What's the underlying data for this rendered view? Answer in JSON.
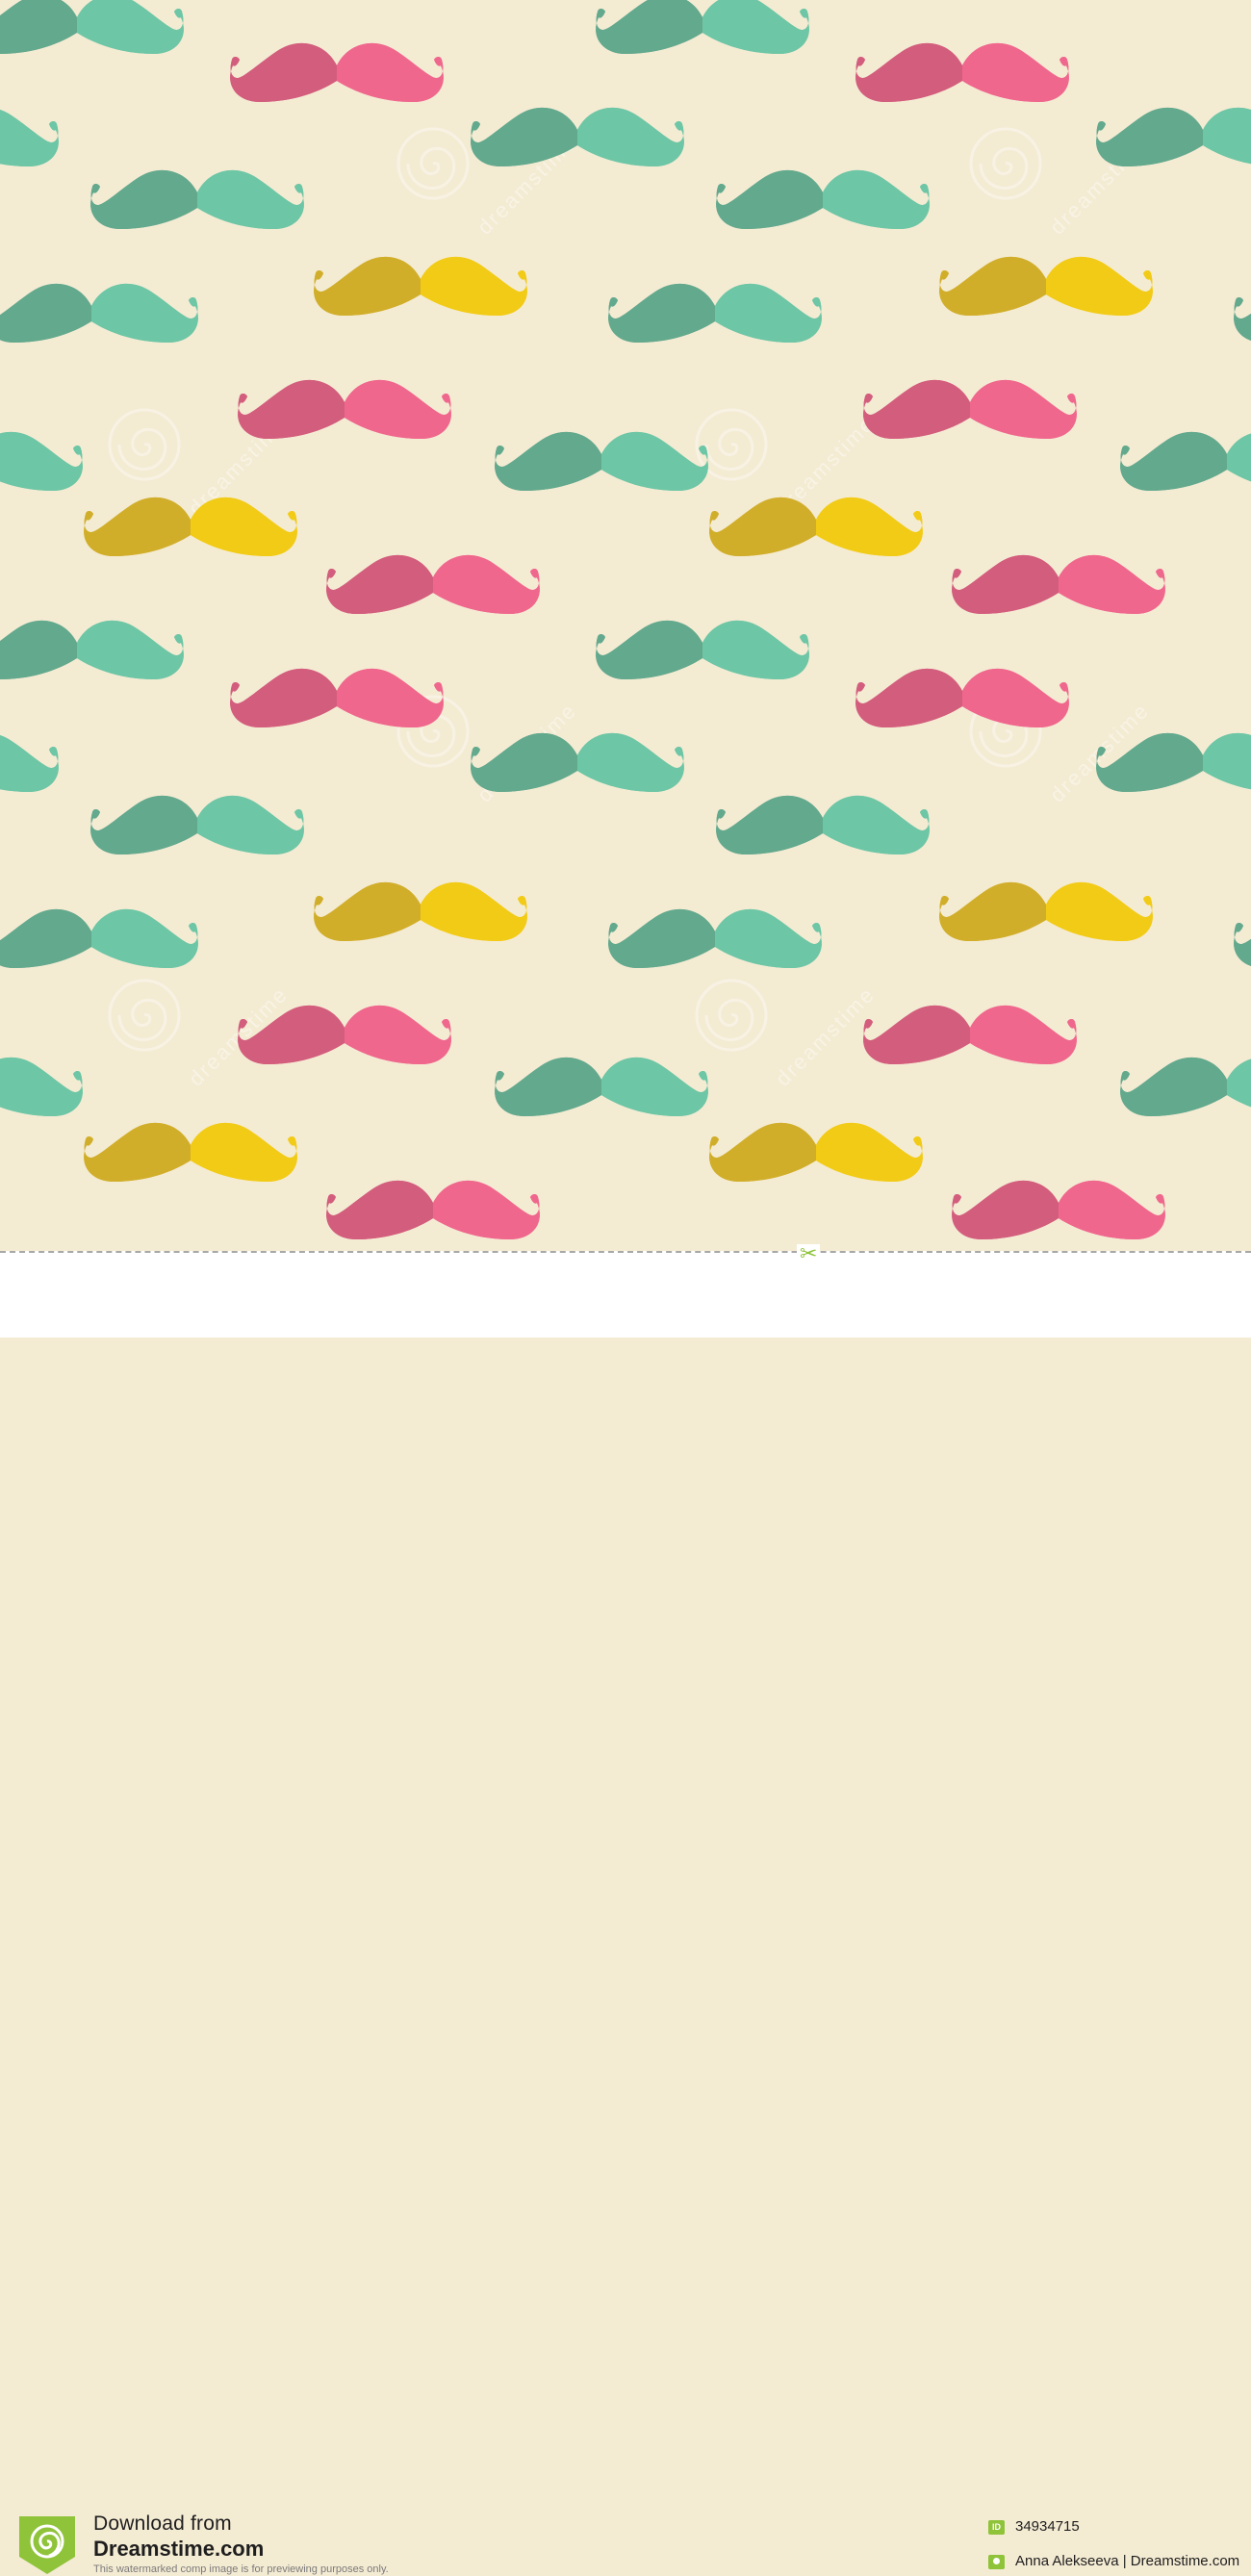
{
  "pattern": {
    "background_color": "#f4ebd3",
    "motif": "mustache-icon",
    "palettes": {
      "green": [
        "#63a98d",
        "#6dc6a5"
      ],
      "pink": [
        "#d35d7d",
        "#f0678d"
      ],
      "yellow": [
        "#d1ae2a",
        "#f2cb16"
      ]
    },
    "watermark": {
      "icon": "spiral-logo-icon",
      "text": "dreamstime"
    }
  },
  "footer": {
    "download_label": "Download from",
    "site_label": "Dreamstime.com",
    "disclaimer": "This watermarked comp image is for previewing purposes only.",
    "id_badge": "ID",
    "image_id": "34934715",
    "author_credit": "Anna Alekseeva | Dreamstime.com",
    "accent_color": "#8fc33a",
    "scissors_icon": "✂"
  }
}
